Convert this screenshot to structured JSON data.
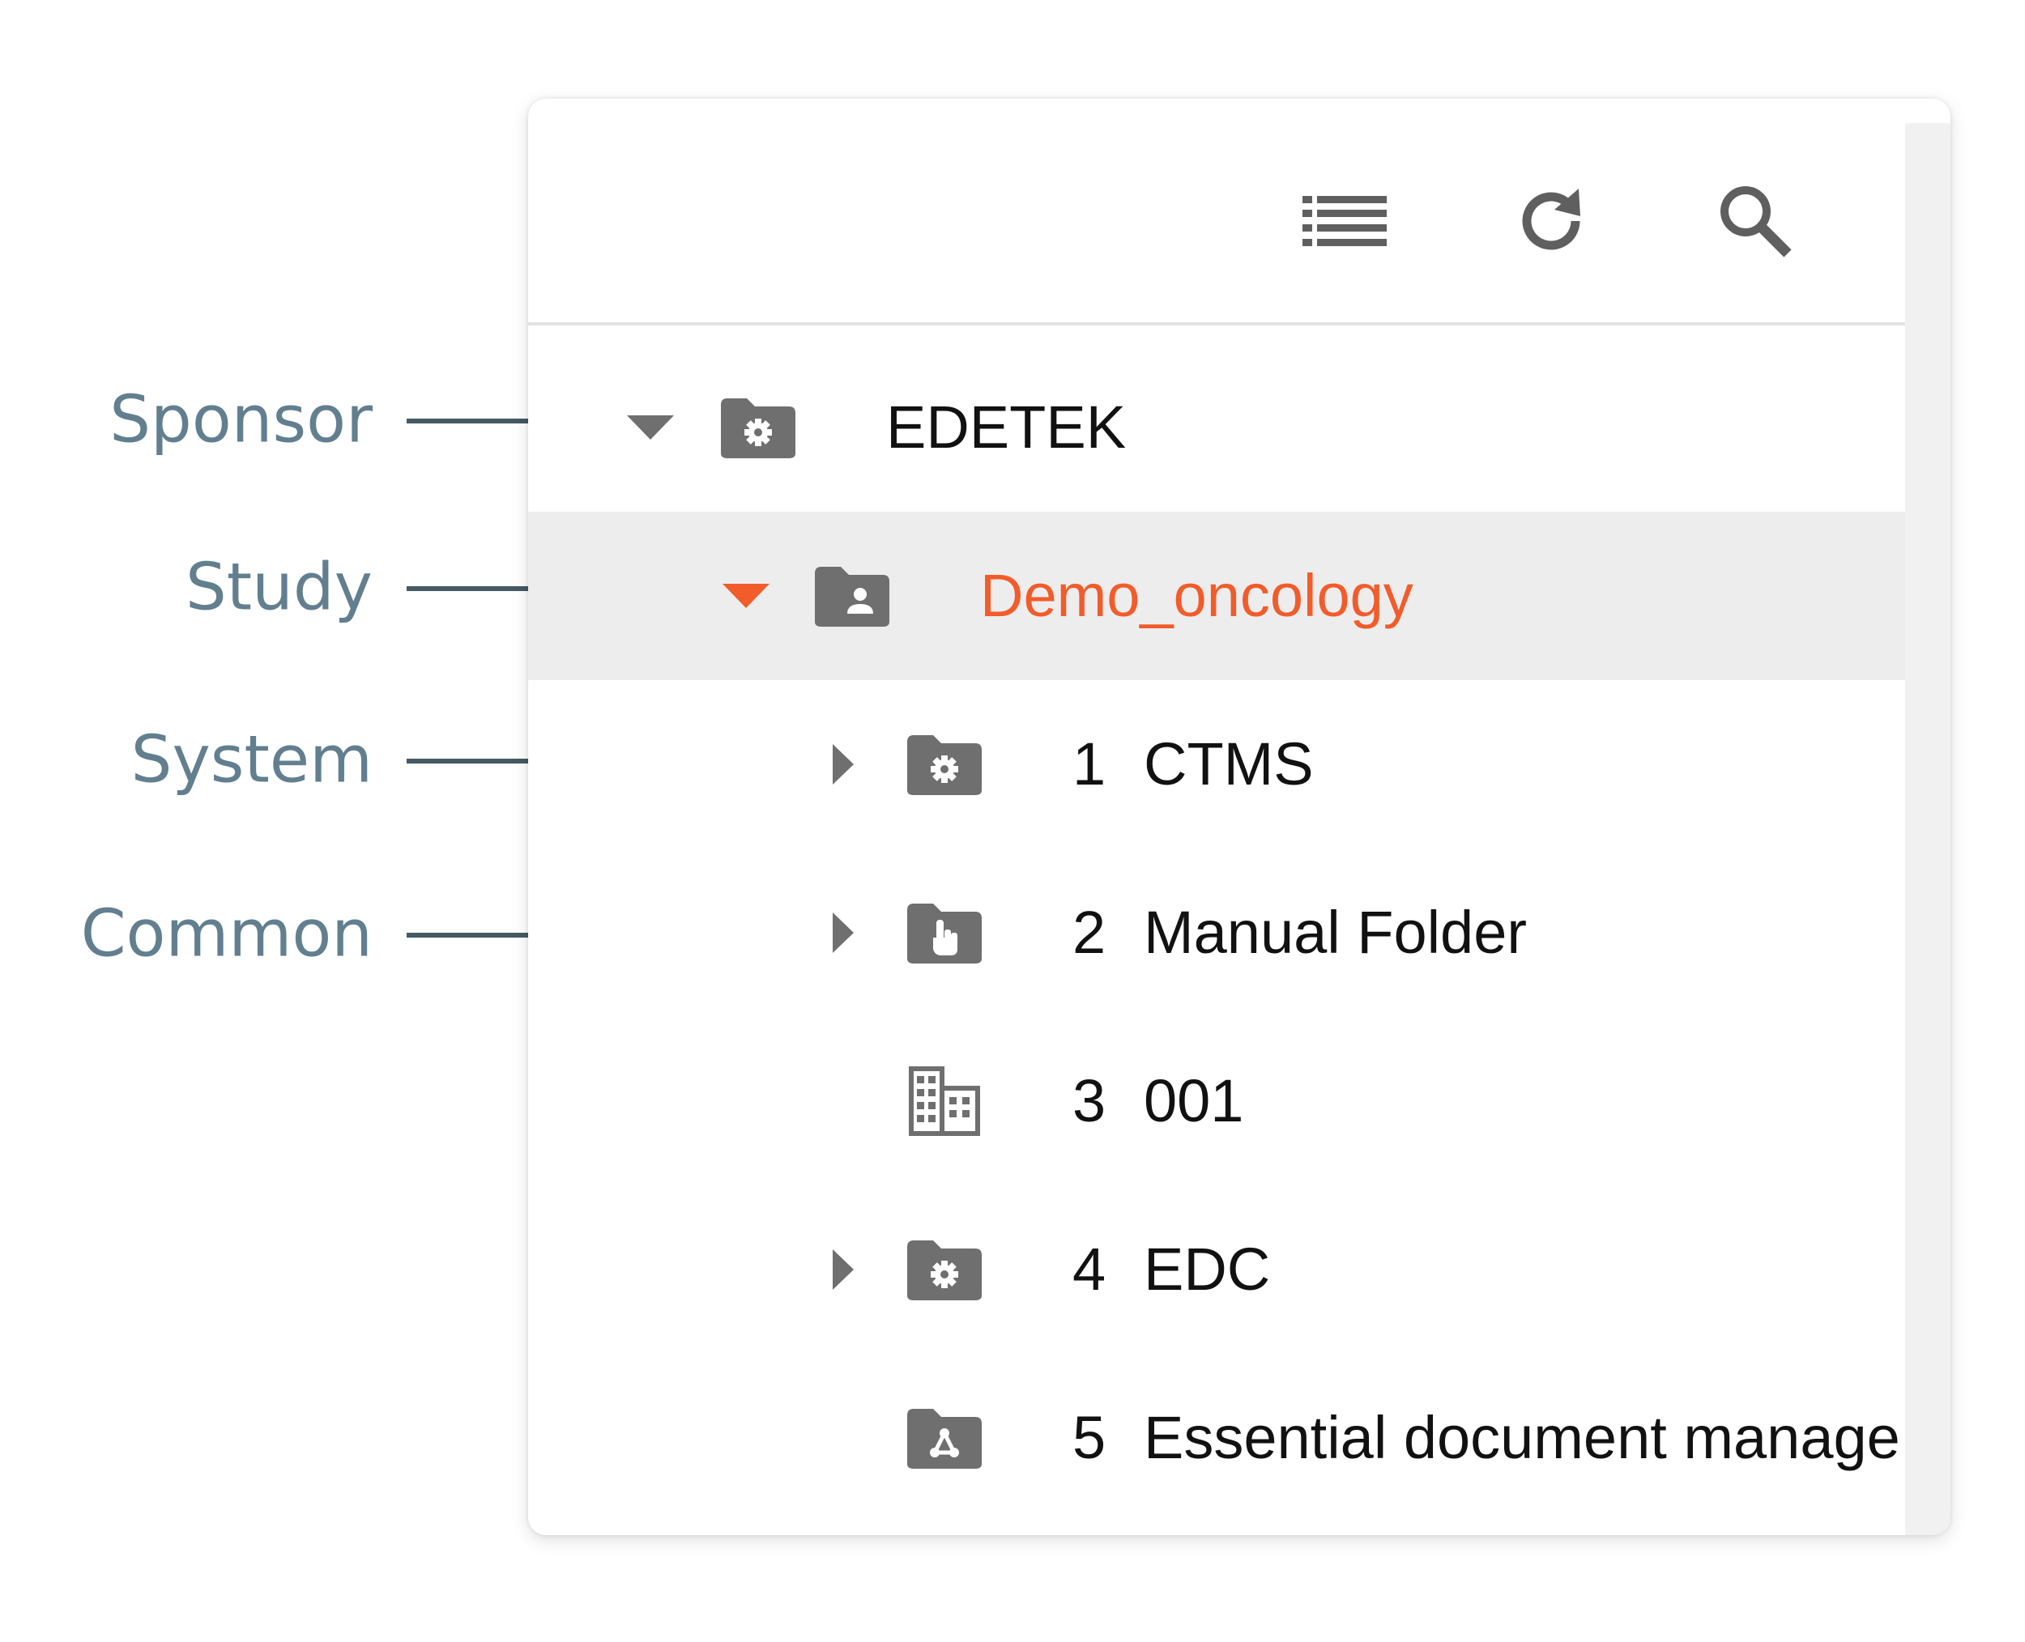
{
  "callouts": [
    {
      "label": "Sponsor"
    },
    {
      "label": "Study"
    },
    {
      "label": "System"
    },
    {
      "label": "Common"
    }
  ],
  "toolbar": {
    "list_icon": "list-icon",
    "refresh_icon": "refresh-icon",
    "search_icon": "search-icon"
  },
  "tree": {
    "sponsor": {
      "label": "EDETEK",
      "icon": "folder-gear-icon",
      "expanded": true
    },
    "study": {
      "label": "Demo_oncology",
      "icon": "folder-person-icon",
      "expanded": true,
      "selected": true
    },
    "items": [
      {
        "num": "1",
        "label": "CTMS",
        "icon": "folder-gear-icon",
        "expandable": true
      },
      {
        "num": "2",
        "label": "Manual Folder",
        "icon": "folder-hand-icon",
        "expandable": true
      },
      {
        "num": "3",
        "label": "001",
        "icon": "building-icon",
        "expandable": false
      },
      {
        "num": "4",
        "label": "EDC",
        "icon": "folder-gear-icon",
        "expandable": true
      },
      {
        "num": "5",
        "label": "Essential document manage",
        "icon": "folder-share-icon",
        "expandable": false
      }
    ]
  },
  "colors": {
    "accent": "#f25c2a",
    "callout_text": "#627f90",
    "callout_line": "#455a64",
    "icon_gray": "#6f6f6f",
    "selected_row": "#ededee"
  }
}
